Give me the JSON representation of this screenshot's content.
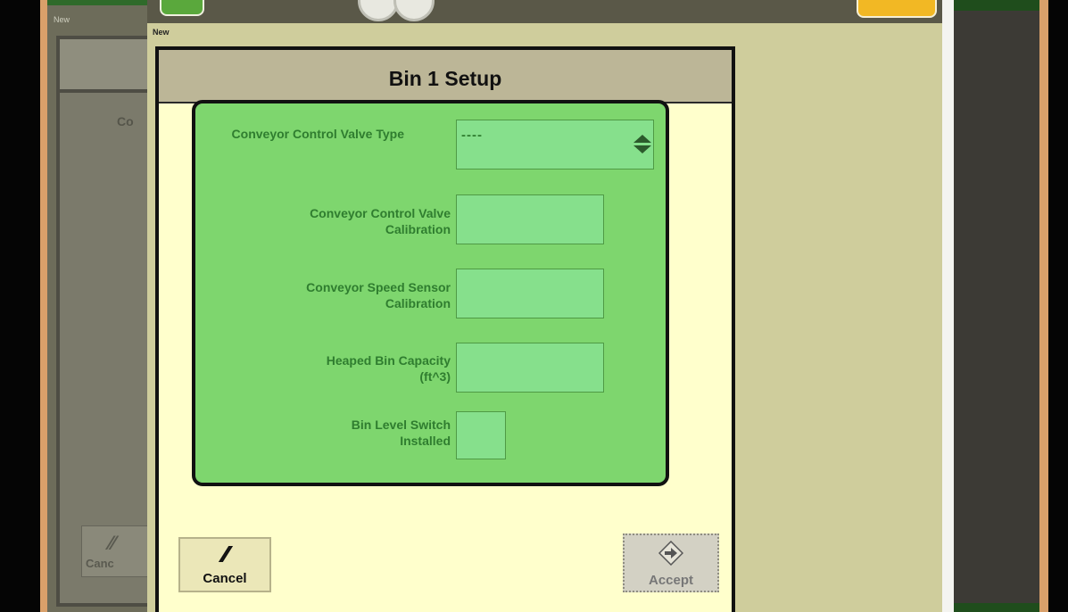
{
  "background": {
    "new_label": "New",
    "partial_label": "Co",
    "partial_cancel": "Canc"
  },
  "screen": {
    "new_label": "New"
  },
  "dialog": {
    "title": "Bin 1 Setup",
    "fields": [
      {
        "label": "Conveyor Control Valve Type",
        "value": "----"
      },
      {
        "label": "Conveyor Control Valve\nCalibration",
        "value": ""
      },
      {
        "label": "Conveyor Speed Sensor\nCalibration",
        "value": ""
      },
      {
        "label": "Heaped Bin Capacity\n(ft^3)",
        "value": ""
      },
      {
        "label": "Bin Level Switch\nInstalled",
        "value": ""
      }
    ],
    "cancel_label": "Cancel",
    "accept_label": "Accept"
  },
  "colors": {
    "panel_green": "#7ed66e",
    "label_green": "#2f7d2f",
    "dialog_bg": "#ffffcc",
    "header_bg": "#bcb697"
  },
  "icons": {
    "cancel": "cancel-slash-icon",
    "accept": "accept-arrow-icon",
    "spinner": "up-down-spinner-icon"
  }
}
